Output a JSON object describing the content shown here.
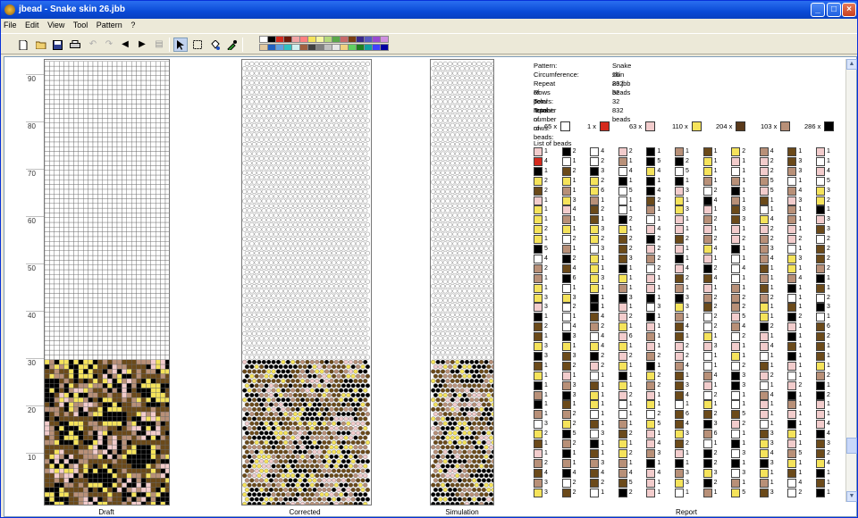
{
  "window": {
    "title": "jbead - Snake skin 26.jbb"
  },
  "menu": [
    "File",
    "Edit",
    "View",
    "Tool",
    "Pattern",
    "?"
  ],
  "toolbar": {
    "icons": [
      "new-icon",
      "open-icon",
      "save-icon",
      "print-icon",
      "undo-icon",
      "redo-icon",
      "scroll-left-icon",
      "scroll-right-icon",
      "delete-icon",
      "select-pointer-icon",
      "rectangle-icon",
      "fill-icon",
      "pipette-icon"
    ]
  },
  "palette": [
    "#ffffff",
    "#000000",
    "#d52b1e",
    "#6a1a0a",
    "#f2a3a3",
    "#ff8080",
    "#f5e35b",
    "#f7f7a0",
    "#b5d97c",
    "#5aa84a",
    "#c86a6a",
    "#7a3f12",
    "#3a2a8a",
    "#5a5abf",
    "#9a4ad0",
    "#d090e0",
    "#e0c8a0",
    "#2060c0",
    "#60a0e0",
    "#30c0c0",
    "#d0f0f0",
    "#a06040",
    "#404040",
    "#808080",
    "#c0c0c0",
    "#e8e8e8",
    "#f0d080",
    "#60d060",
    "#208020",
    "#10a0a0",
    "#4040ff",
    "#0000a0"
  ],
  "ruler": [
    90,
    80,
    70,
    60,
    50,
    40,
    30,
    20,
    10
  ],
  "panels": {
    "draft": "Draft",
    "corrected": "Corrected",
    "simulation": "Simulation",
    "report": "Report"
  },
  "report": {
    "pattern_label": "Pattern:",
    "pattern": "Snake skin 26.jbb",
    "circ_label": "Circumference:",
    "circ": "26",
    "repeat_label": "Repeat of colors:",
    "repeat": "832 beads",
    "rows_label": "Rows per repeat:",
    "rows": "32",
    "total_rows_label": "Total number of rows:",
    "total_rows": "32",
    "total_beads_label": "Total number of beads:",
    "total_beads": "832 beads",
    "counts": [
      {
        "text": "65 x",
        "color": "#ffffff"
      },
      {
        "text": "1 x",
        "color": "#d52b1e"
      },
      {
        "text": "63 x",
        "color": "#f2cccc"
      },
      {
        "text": "110 x",
        "color": "#f5e35b"
      },
      {
        "text": "204 x",
        "color": "#5a3a1a"
      },
      {
        "text": "103 x",
        "color": "#b89078"
      },
      {
        "text": "286 x",
        "color": "#000000"
      }
    ],
    "list_label": "List of beads"
  }
}
